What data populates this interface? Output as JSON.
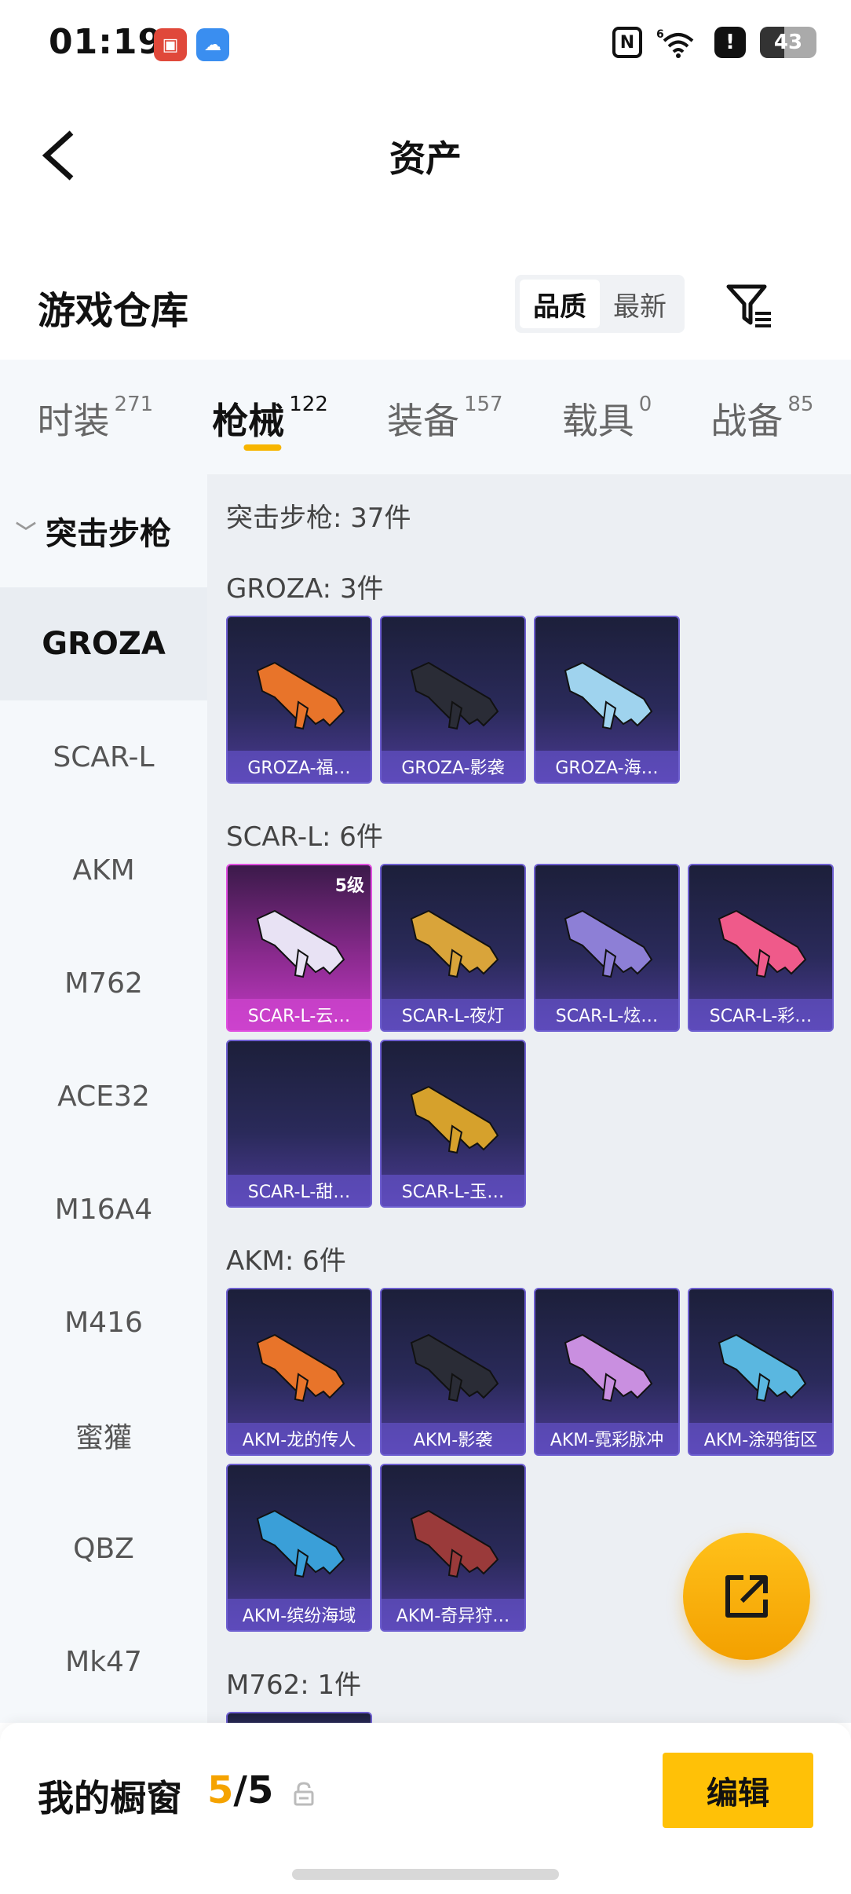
{
  "status_bar": {
    "time": "01:19",
    "battery": "43",
    "battery_level": 0.43,
    "signal": "6"
  },
  "header": {
    "title": "资产"
  },
  "warehouse": {
    "title": "游戏仓库",
    "sort_options": [
      "品质",
      "最新"
    ],
    "active_sort": "品质"
  },
  "tabs": [
    {
      "label": "时装",
      "count": "271"
    },
    {
      "label": "枪械",
      "count": "122",
      "active": true
    },
    {
      "label": "装备",
      "count": "157"
    },
    {
      "label": "载具",
      "count": "0"
    },
    {
      "label": "战备",
      "count": "85"
    }
  ],
  "sidebar": {
    "category": "突击步枪",
    "items": [
      "GROZA",
      "SCAR-L",
      "AKM",
      "M762",
      "ACE32",
      "M16A4",
      "M416",
      "蜜獾",
      "QBZ",
      "Mk47"
    ],
    "active": "GROZA"
  },
  "content": {
    "category_header": "突击步枪: 37件",
    "groups": [
      {
        "title": "GROZA: 3件",
        "items": [
          {
            "name": "GROZA-福…",
            "style": "normal",
            "gun_color": "#e8742a"
          },
          {
            "name": "GROZA-影袭",
            "style": "normal",
            "gun_color": "#2a2c36"
          },
          {
            "name": "GROZA-海…",
            "style": "normal",
            "gun_color": "#9fd3ee"
          }
        ]
      },
      {
        "title": "SCAR-L: 6件",
        "items": [
          {
            "name": "SCAR-L-云…",
            "style": "pink",
            "badge": "5级",
            "gun_color": "#e8e2f4"
          },
          {
            "name": "SCAR-L-夜灯",
            "style": "normal",
            "gun_color": "#d9a43a"
          },
          {
            "name": "SCAR-L-炫…",
            "style": "normal",
            "gun_color": "#8d7fd6"
          },
          {
            "name": "SCAR-L-彩…",
            "style": "normal",
            "gun_color": "#ef5a8a"
          },
          {
            "name": "SCAR-L-甜…",
            "style": "normal",
            "gun_color": ""
          },
          {
            "name": "SCAR-L-玉…",
            "style": "normal",
            "gun_color": "#d6a12c"
          }
        ]
      },
      {
        "title": "AKM: 6件",
        "items": [
          {
            "name": "AKM-龙的传人",
            "style": "normal",
            "gun_color": "#e8742a"
          },
          {
            "name": "AKM-影袭",
            "style": "normal",
            "gun_color": "#2a2c36"
          },
          {
            "name": "AKM-霓彩脉冲",
            "style": "normal",
            "gun_color": "#c98fe0"
          },
          {
            "name": "AKM-涂鸦街区",
            "style": "normal",
            "gun_color": "#5ab7e0"
          },
          {
            "name": "AKM-缤纷海域",
            "style": "normal",
            "gun_color": "#3a9fd8"
          },
          {
            "name": "AKM-奇异狩…",
            "style": "normal",
            "gun_color": "#9a3a3a"
          }
        ]
      },
      {
        "title": "M762: 1件",
        "items": []
      }
    ]
  },
  "bottom": {
    "label": "我的橱窗",
    "current": "5",
    "separator": "/",
    "max": "5",
    "edit_label": "编辑"
  },
  "colors": {
    "accent": "#f7b500",
    "card_border": "#6e5fd0",
    "pink_card": "#c23ac4"
  }
}
